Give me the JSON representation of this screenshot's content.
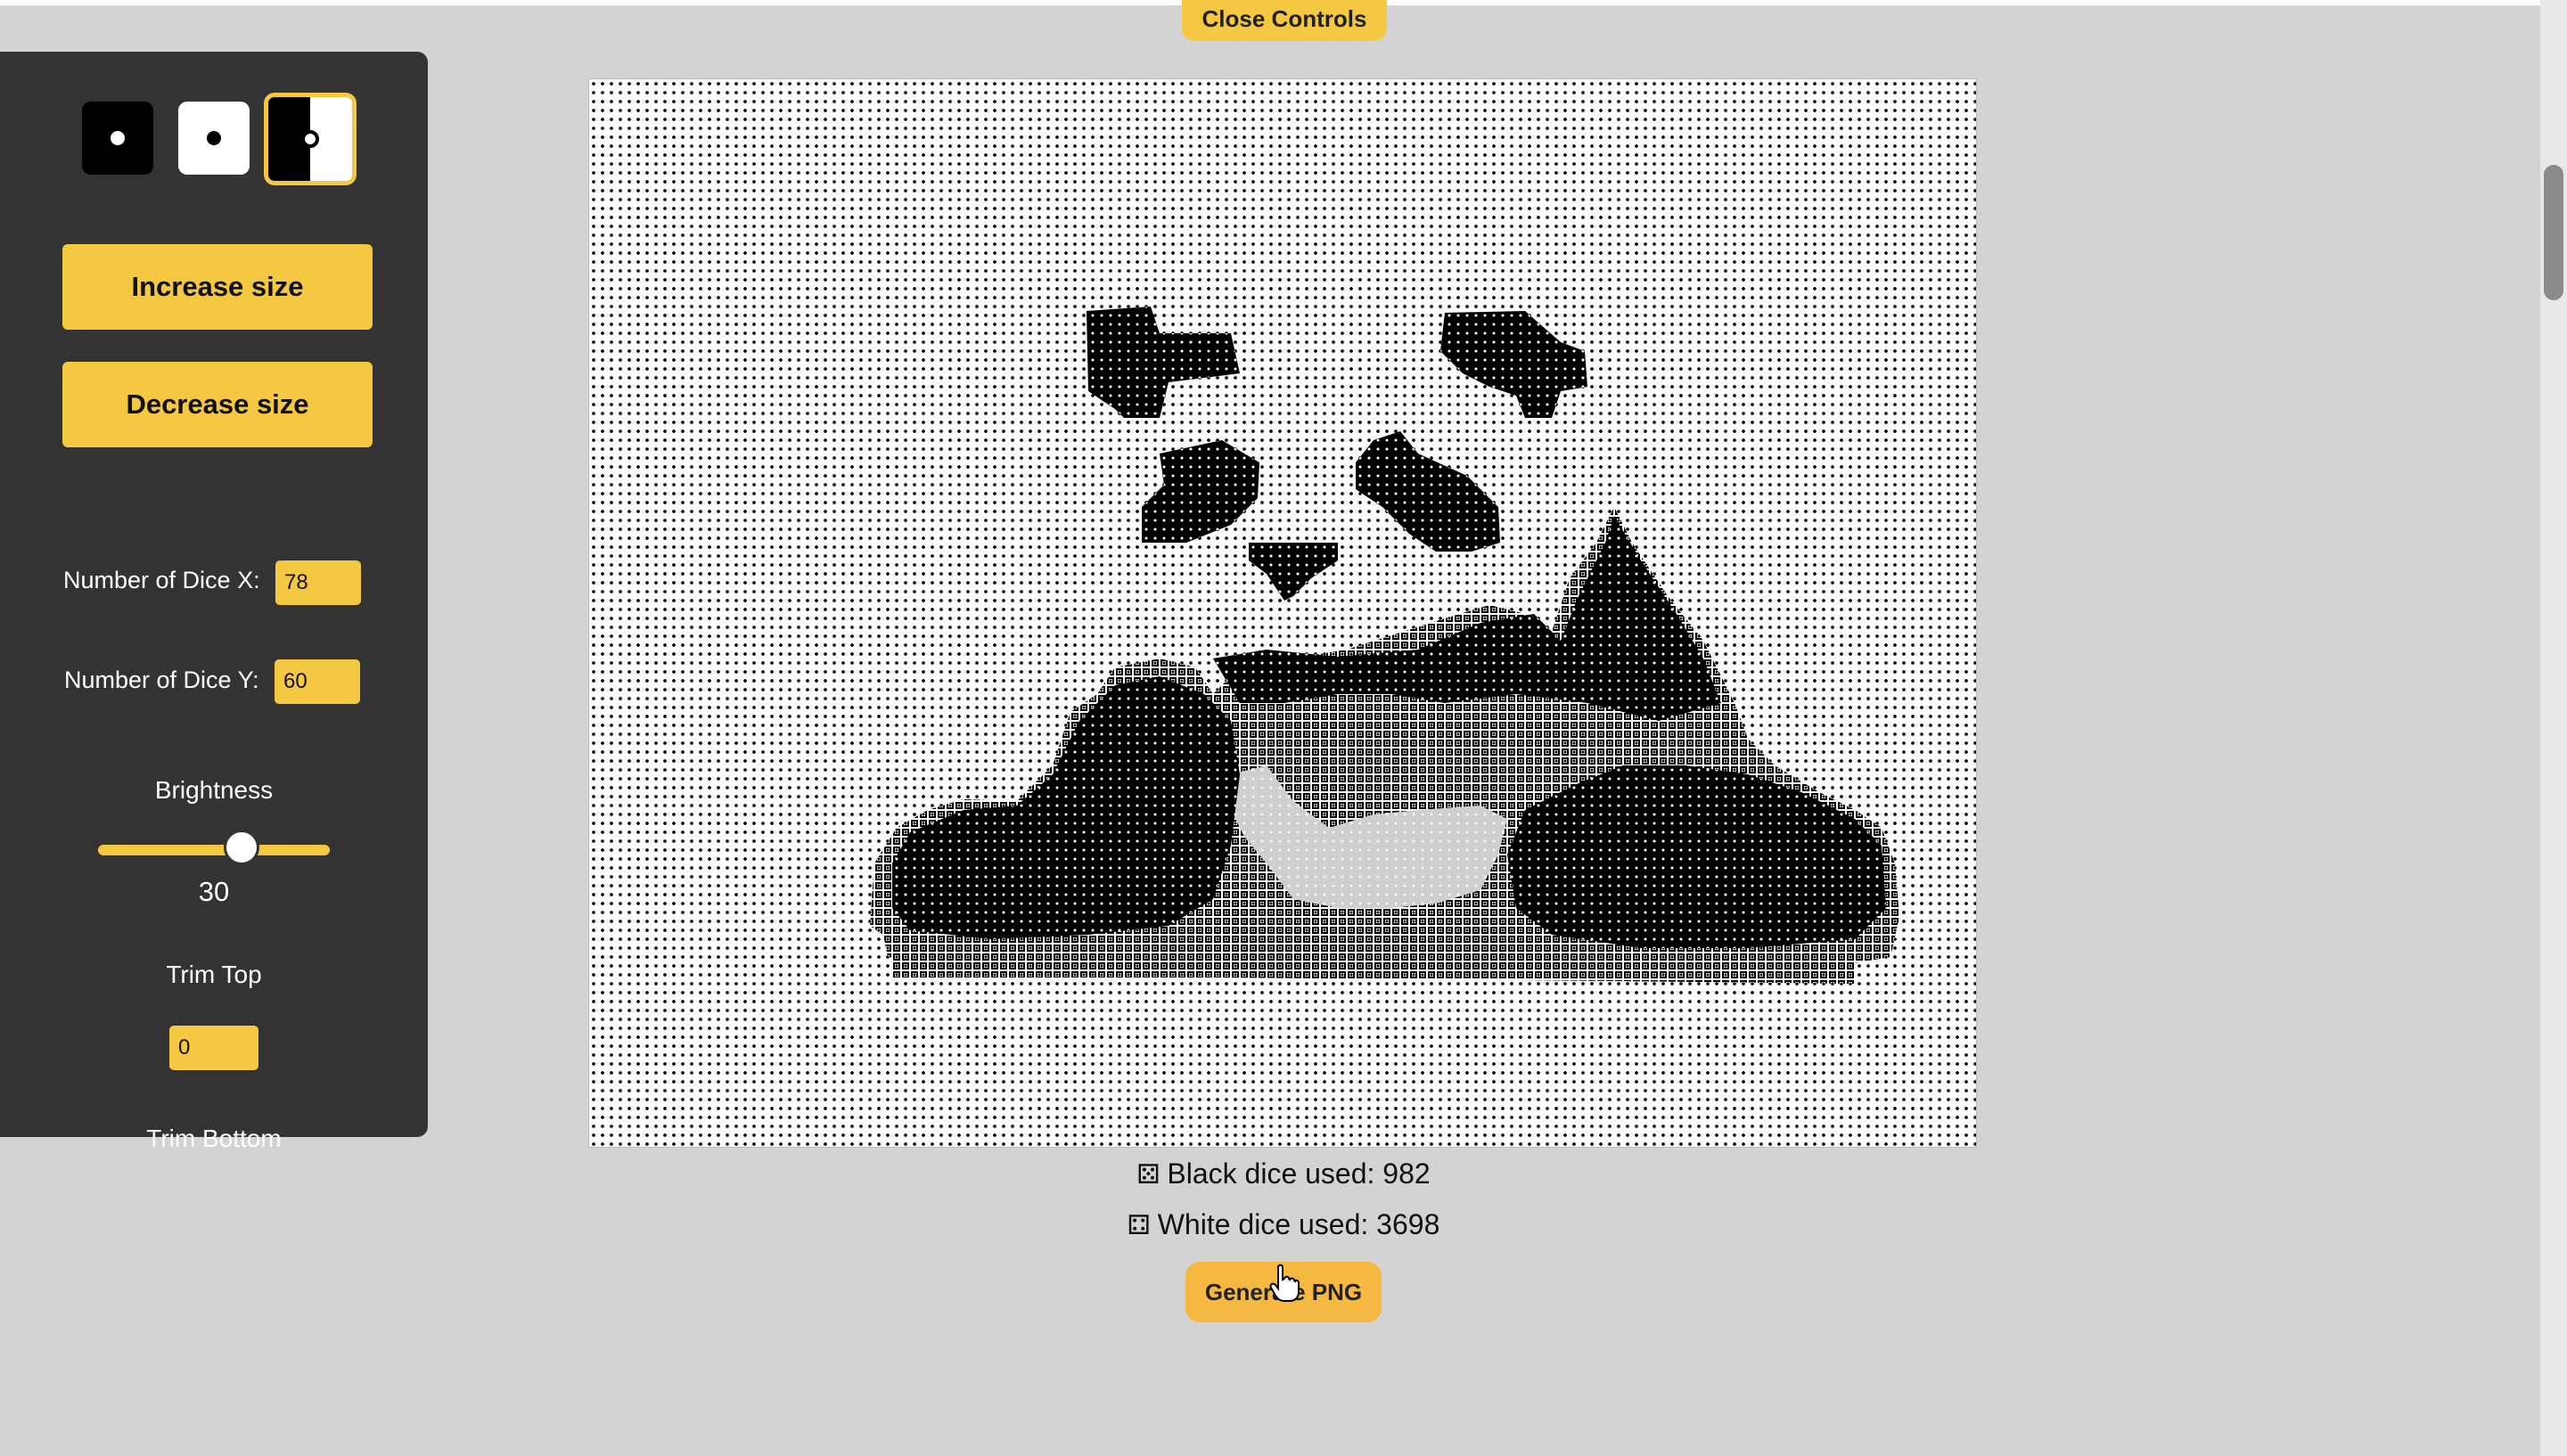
{
  "controls": {
    "close_label": "Close Controls",
    "dice_styles": [
      {
        "name": "black-die",
        "selected": false
      },
      {
        "name": "white-die",
        "selected": false
      },
      {
        "name": "mixed-die",
        "selected": true
      }
    ],
    "increase_label": "Increase size",
    "decrease_label": "Decrease size",
    "dice_x_label": "Number of Dice X:",
    "dice_x_value": "78",
    "dice_y_label": "Number of Dice Y:",
    "dice_y_value": "60",
    "brightness_label": "Brightness",
    "brightness_value": "30",
    "brightness_fraction": 0.62,
    "trim_top_label": "Trim Top",
    "trim_top_value": "0",
    "trim_bottom_label": "Trim Bottom"
  },
  "stats": {
    "black_icon": "⚄",
    "black_label": "Black dice used: 982",
    "white_icon": "⚃",
    "white_label": "White dice used: 3698"
  },
  "generate_label": "Generate PNG",
  "colors": {
    "accent": "#f5c842",
    "panel": "#333333",
    "page": "#d3d3d3"
  }
}
